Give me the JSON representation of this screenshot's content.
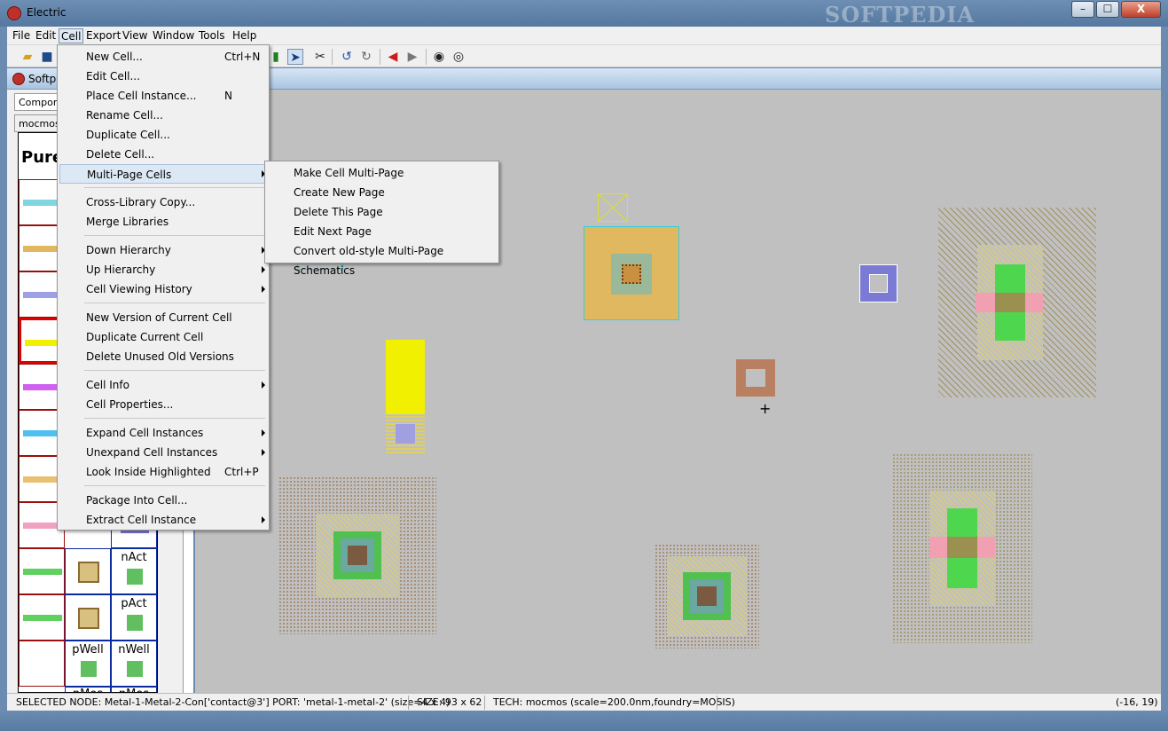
{
  "window": {
    "title": "Electric",
    "watermark": "SOFTPEDIA",
    "minimize": "–",
    "maximize": "☐",
    "close": "X"
  },
  "menubar": [
    "File",
    "Edit",
    "Cell",
    "Export",
    "View",
    "Window",
    "Tools",
    "Help"
  ],
  "document": {
    "title": "Softpe"
  },
  "left_panel": {
    "tab_components": "Compone",
    "tab_library": "mocmos",
    "palette_header": "Pure",
    "cell_labels": [
      "nAct",
      "pAct",
      "pWell",
      "nWell",
      "pMos",
      "nMos"
    ]
  },
  "cell_menu": {
    "items": [
      {
        "label": "New Cell...",
        "shortcut": "Ctrl+N"
      },
      {
        "label": "Edit Cell...",
        "shortcut": ""
      },
      {
        "label": "Place Cell Instance...",
        "shortcut": "N"
      },
      {
        "label": "Rename Cell...",
        "shortcut": ""
      },
      {
        "label": "Duplicate Cell...",
        "shortcut": ""
      },
      {
        "label": "Delete Cell...",
        "shortcut": ""
      },
      {
        "label": "Multi-Page Cells",
        "shortcut": ""
      },
      {
        "label": "Cross-Library Copy...",
        "shortcut": ""
      },
      {
        "label": "Merge Libraries",
        "shortcut": ""
      },
      {
        "label": "Down Hierarchy",
        "shortcut": ""
      },
      {
        "label": "Up Hierarchy",
        "shortcut": ""
      },
      {
        "label": "Cell Viewing History",
        "shortcut": ""
      },
      {
        "label": "New Version of Current Cell",
        "shortcut": ""
      },
      {
        "label": "Duplicate Current Cell",
        "shortcut": ""
      },
      {
        "label": "Delete Unused Old Versions",
        "shortcut": ""
      },
      {
        "label": "Cell Info",
        "shortcut": ""
      },
      {
        "label": "Cell Properties...",
        "shortcut": ""
      },
      {
        "label": "Expand Cell Instances",
        "shortcut": ""
      },
      {
        "label": "Unexpand Cell Instances",
        "shortcut": ""
      },
      {
        "label": "Look Inside Highlighted",
        "shortcut": "Ctrl+P"
      },
      {
        "label": "Package Into Cell...",
        "shortcut": ""
      },
      {
        "label": "Extract Cell Instance",
        "shortcut": ""
      }
    ]
  },
  "submenu": {
    "items": [
      "Make Cell Multi-Page",
      "Create New Page",
      "Delete This Page",
      "Edit Next Page",
      "Convert old-style Multi-Page Schematics"
    ]
  },
  "status": {
    "selected": "SELECTED NODE: Metal-1-Metal-2-Con['contact@3'] PORT: 'metal-1-metal-2' (size=4 x 4)",
    "size": "SIZE: 93 x 62",
    "tech": "TECH: mocmos (scale=200.0nm,foundry=MOSIS)",
    "coords": "(-16, 19)"
  },
  "colors": {
    "canvas": "#c0c0c0",
    "menu_highlight": "#dde8f5",
    "metal1": "#7b7bd6",
    "poly": "#e8a6b0",
    "active": "#4fd64f"
  }
}
